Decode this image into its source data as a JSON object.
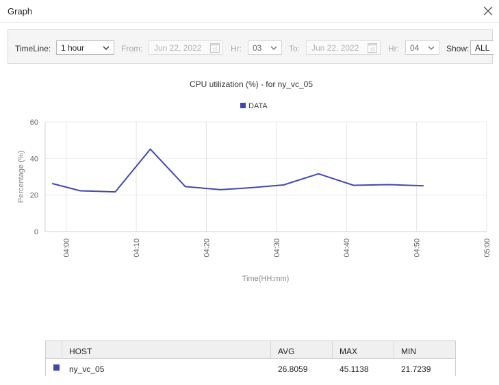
{
  "window": {
    "title": "Graph",
    "close_icon": "close-icon"
  },
  "toolbar": {
    "timeline_label": "TimeLine:",
    "timeline_value": "1 hour",
    "from_label": "From:",
    "from_date": "Jun 22, 2022",
    "from_hr_label": "Hr:",
    "from_hr": "03",
    "to_label": "To:",
    "to_date": "Jun 22, 2022",
    "to_hr_label": "Hr:",
    "to_hr": "04",
    "show_label": "Show:",
    "show_value": "ALL",
    "calendar_icon": "calendar-icon",
    "dropdown_icon": "chevron-down-icon"
  },
  "chart_data": {
    "type": "line",
    "title": "CPU utilization (%) - for ny_vc_05",
    "xlabel": "Time(HH:mm)",
    "ylabel": "Percentage (%)",
    "legend": "top-center",
    "grid": true,
    "ylim": [
      0,
      60
    ],
    "yticks": [
      0,
      20,
      40,
      60
    ],
    "xlim": [
      "03:57",
      "05:00"
    ],
    "xticks": [
      "04:00",
      "04:10",
      "04:20",
      "04:30",
      "04:40",
      "04:50",
      "05:00"
    ],
    "series": [
      {
        "name": "DATA",
        "color": "#3f48b0",
        "x": [
          "03:58",
          "04:02",
          "04:07",
          "04:12",
          "04:17",
          "04:22",
          "04:26",
          "04:31",
          "04:36",
          "04:41",
          "04:46",
          "04:51"
        ],
        "y": [
          26.3,
          22.3,
          21.7,
          45.1,
          24.6,
          22.9,
          23.9,
          25.5,
          31.6,
          25.3,
          25.7,
          25.0
        ]
      }
    ]
  },
  "summary_table": {
    "columns": [
      "HOST",
      "AVG",
      "MAX",
      "MIN"
    ],
    "rows": [
      {
        "color": "#3f48b0",
        "host": "ny_vc_05",
        "avg": "26.8059",
        "max": "45.1138",
        "min": "21.7239"
      }
    ]
  }
}
